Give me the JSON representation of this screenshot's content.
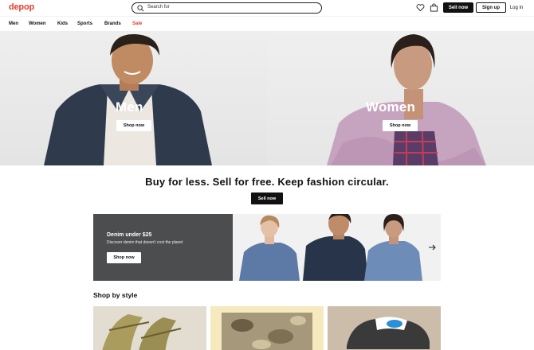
{
  "header": {
    "logo": "depop",
    "search_placeholder": "Search for",
    "sell_label": "Sell now",
    "signup_label": "Sign up",
    "login_label": "Log in",
    "icons": [
      "search-icon",
      "heart-icon",
      "bag-icon"
    ]
  },
  "nav": {
    "items": [
      {
        "label": "Men"
      },
      {
        "label": "Women"
      },
      {
        "label": "Kids"
      },
      {
        "label": "Sports"
      },
      {
        "label": "Brands"
      },
      {
        "label": "Sale"
      }
    ]
  },
  "hero": {
    "left": {
      "title": "Men",
      "button": "Shop now"
    },
    "right": {
      "title": "Women",
      "button": "Shop now"
    }
  },
  "tagline": {
    "text": "Buy for less. Sell for free. Keep fashion circular.",
    "button": "Sell now"
  },
  "promo": {
    "title": "Denim under $25",
    "subtitle": "Discover denim that doesn't cost the planet",
    "button": "Shop now"
  },
  "shop_by_style": {
    "heading": "Shop by style"
  },
  "colors": {
    "brand": "#e63a2f",
    "dark": "#111111",
    "promo_panel": "#4b4d4f"
  }
}
